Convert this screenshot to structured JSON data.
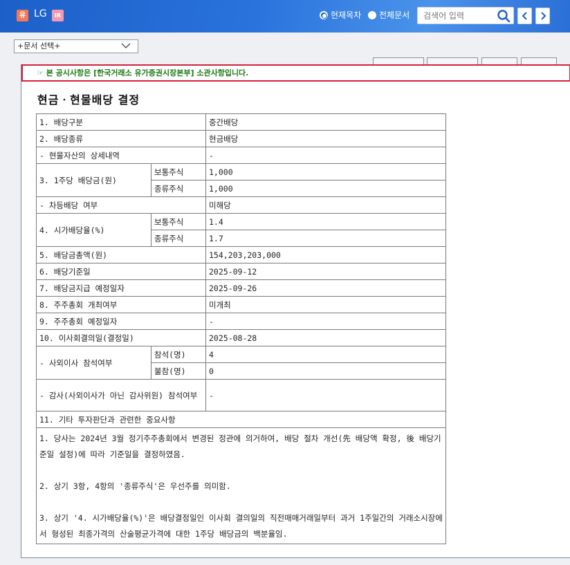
{
  "header": {
    "market_badge": "유",
    "company": "LG",
    "ir_badge": "IR",
    "radio_current_label": "현재목차",
    "radio_all_label": "전체문서",
    "search_placeholder": "검색어 입력",
    "accent_color": "#2a73dc"
  },
  "doc_select": {
    "value": "+문서 선택+"
  },
  "notice": "☞ 본 공시사항은 [한국거래소 유가증권시장본부] 소관사항입니다.",
  "title": "현금ㆍ현물배당 결정",
  "table": {
    "r1_label": "1. 배당구분",
    "r1_value": "중간배당",
    "r2_label": "2. 배당종류",
    "r2_value": "현금배당",
    "r3_label": "- 현물자산의 상세내역",
    "r3_value": "-",
    "r4_label": "3. 1주당 배당금(원)",
    "r4_sub1": "보통주식",
    "r4_val1": "1,000",
    "r4_sub2": "종류주식",
    "r4_val2": "1,000",
    "r5_label": "- 차등배당 여부",
    "r5_value": "미해당",
    "r6_label": "4. 시가배당율(%)",
    "r6_sub1": "보통주식",
    "r6_val1": "1.4",
    "r6_sub2": "종류주식",
    "r6_val2": "1.7",
    "r7_label": "5. 배당금총액(원)",
    "r7_value": "154,203,203,000",
    "r8_label": "6. 배당기준일",
    "r8_value": "2025-09-12",
    "r9_label": "7. 배당금지급 예정일자",
    "r9_value": "2025-09-26",
    "r10_label": "8. 주주총회 개최여부",
    "r10_value": "미개최",
    "r11_label": "9. 주주총회 예정일자",
    "r11_value": "-",
    "r12_label": "10. 이사회결의일(결정일)",
    "r12_value": "2025-08-28",
    "r13_label": "- 사외이사 참석여부",
    "r13_sub1": "참석(명)",
    "r13_val1": "4",
    "r13_sub2": "불참(명)",
    "r13_val2": "0",
    "r14_label": "- 감사(사외이사가 아닌 감사위원) 참석여부",
    "r14_value": "-",
    "r15_label": "11. 기타 투자판단과 관련한 중요사항",
    "other_notes": [
      "1. 당사는 2024년 3월 정기주주총회에서 변경된 정관에 의거하여, 배당 절차 개선(先 배당액 확정, 後 배당기준일 설정)에 따라 기준일을 결정하였음.",
      "2. 상기 3항, 4항의 '종류주식'은 우선주를 의미함.",
      "3. 상기 '4. 시가배당율(%)'은 배당결정일인 이사회 결의일의 직전매매거래일부터 과거 1주일간의 거래소시장에서 형성된 최종가격의 산술평균가격에 대한 1주당 배당금의 백분율임."
    ]
  }
}
